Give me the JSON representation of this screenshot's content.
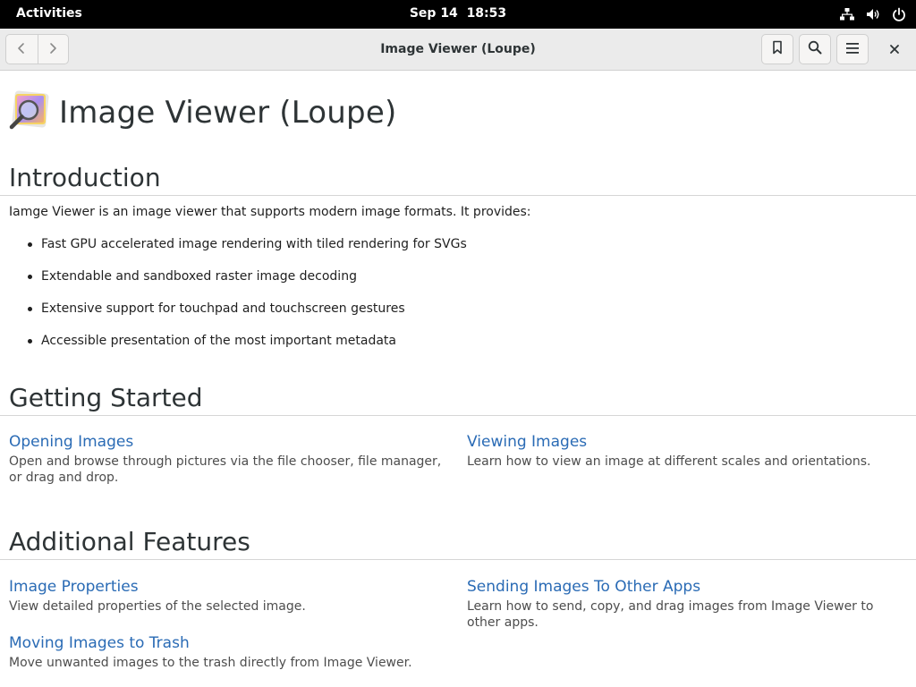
{
  "topbar": {
    "activities": "Activities",
    "date": "Sep 14",
    "time": "18:53",
    "tray_icons": [
      "network-icon",
      "volume-icon",
      "power-icon"
    ]
  },
  "headerbar": {
    "title": "Image Viewer (Loupe)",
    "buttons": [
      "back-icon",
      "forward-icon",
      "bookmark-icon",
      "search-icon",
      "menu-icon",
      "close-icon"
    ]
  },
  "page": {
    "title": "Image Viewer (Loupe)"
  },
  "introduction": {
    "heading": "Introduction",
    "text": "Iamge Viewer is an image viewer that supports modern image formats. It provides:",
    "bullets": [
      "Fast GPU accelerated image rendering with tiled rendering for SVGs",
      "Extendable and sandboxed raster image decoding",
      "Extensive support for touchpad and touchscreen gestures",
      "Accessible presentation of the most important metadata"
    ]
  },
  "getting_started": {
    "heading": "Getting Started",
    "links": [
      {
        "title": "Opening Images",
        "desc": "Open and browse through pictures via the file chooser, file manager, or drag and drop."
      },
      {
        "title": "Viewing Images",
        "desc": "Learn how to view an image at different scales and orientations."
      }
    ]
  },
  "additional_features": {
    "heading": "Additional Features",
    "links": [
      {
        "title": "Image Properties",
        "desc": "View detailed properties of the selected image."
      },
      {
        "title": "Sending Images To Other Apps",
        "desc": "Learn how to send, copy, and drag images from Image Viewer to other apps."
      },
      {
        "title": "Moving Images to Trash",
        "desc": "Move unwanted images to the trash directly from Image Viewer."
      }
    ]
  },
  "colors": {
    "link": "#2a6bb5",
    "topbar": "#000000",
    "headerbar": "#ebebeb"
  }
}
